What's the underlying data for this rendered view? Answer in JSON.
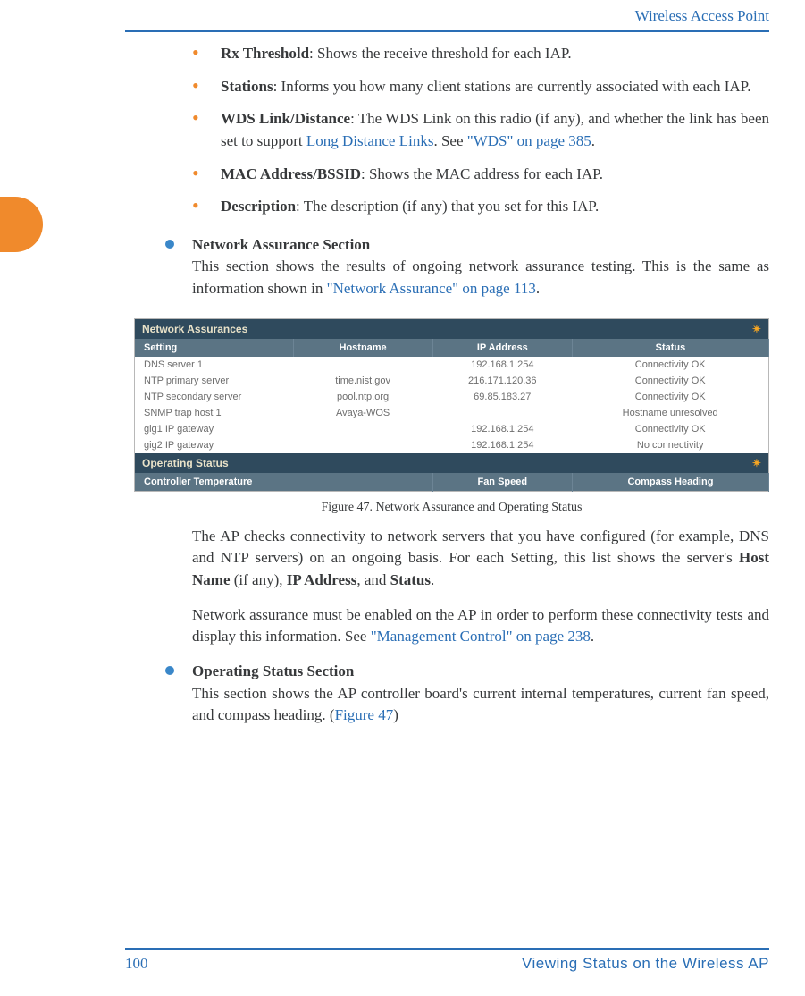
{
  "header": {
    "title": "Wireless Access Point"
  },
  "bullets": [
    {
      "term": "Rx Threshold",
      "text": ": Shows the receive threshold for each IAP."
    },
    {
      "term": "Stations",
      "text": ": Informs you how many client stations are currently associated with each IAP."
    },
    {
      "term": "WDS Link/Distance",
      "text_before": ": The WDS Link on this radio (if any), and whether the link has been set to support ",
      "link1": "Long Distance Links",
      "mid": ". See ",
      "link2": "\"WDS\" on page 385",
      "after": "."
    },
    {
      "term": "MAC Address/BSSID",
      "text": ": Shows the MAC address for each IAP."
    },
    {
      "term": "Description",
      "text": ": The description (if any) that you set for this IAP."
    }
  ],
  "section1": {
    "head": "Network Assurance Section",
    "intro_before": "This section shows the results of ongoing network assurance testing. This is the same as information shown in ",
    "intro_link": "\"Network Assurance\" on page 113",
    "intro_after": "."
  },
  "figure": {
    "title_assur": "Network Assurances",
    "cols_assur": [
      "Setting",
      "Hostname",
      "IP Address",
      "Status"
    ],
    "rows": [
      [
        "DNS server 1",
        "",
        "192.168.1.254",
        "Connectivity OK"
      ],
      [
        "NTP primary server",
        "time.nist.gov",
        "216.171.120.36",
        "Connectivity OK"
      ],
      [
        "NTP secondary server",
        "pool.ntp.org",
        "69.85.183.27",
        "Connectivity OK"
      ],
      [
        "SNMP trap host 1",
        "Avaya-WOS",
        "",
        "Hostname unresolved"
      ],
      [
        "gig1 IP gateway",
        "",
        "192.168.1.254",
        "Connectivity OK"
      ],
      [
        "gig2 IP gateway",
        "",
        "192.168.1.254",
        "No connectivity"
      ]
    ],
    "title_oper": "Operating Status",
    "cols_oper": [
      "Controller Temperature",
      "Fan Speed",
      "Compass Heading"
    ],
    "caption": "Figure 47. Network Assurance and Operating Status"
  },
  "post_figure": {
    "p1_before": "The AP checks connectivity to network servers that you have configured (for example, DNS and NTP servers) on an ongoing basis. For each Setting, this list shows the server's ",
    "b1": "Host Name",
    "m1": " (if any), ",
    "b2": "IP Address",
    "m2": ", and ",
    "b3": "Status",
    "after1": ".",
    "p2_before": "Network assurance must be enabled on the AP in order to perform these connectivity tests and display this information. See ",
    "p2_link": "\"Management Control\" on page 238",
    "p2_after": "."
  },
  "section2": {
    "head": "Operating Status Section",
    "text_before": "This section shows the AP controller board's current internal temperatures, current fan speed, and compass heading. (",
    "link": "Figure 47",
    "text_after": ")"
  },
  "footer": {
    "page": "100",
    "section": "Viewing Status on the Wireless AP"
  }
}
